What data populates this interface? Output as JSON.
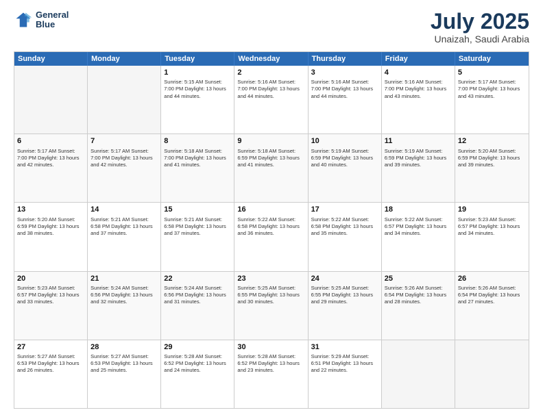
{
  "header": {
    "logo_line1": "General",
    "logo_line2": "Blue",
    "month": "July 2025",
    "location": "Unaizah, Saudi Arabia"
  },
  "days_of_week": [
    "Sunday",
    "Monday",
    "Tuesday",
    "Wednesday",
    "Thursday",
    "Friday",
    "Saturday"
  ],
  "rows": [
    [
      {
        "day": "",
        "info": ""
      },
      {
        "day": "",
        "info": ""
      },
      {
        "day": "1",
        "info": "Sunrise: 5:15 AM\nSunset: 7:00 PM\nDaylight: 13 hours\nand 44 minutes."
      },
      {
        "day": "2",
        "info": "Sunrise: 5:16 AM\nSunset: 7:00 PM\nDaylight: 13 hours\nand 44 minutes."
      },
      {
        "day": "3",
        "info": "Sunrise: 5:16 AM\nSunset: 7:00 PM\nDaylight: 13 hours\nand 44 minutes."
      },
      {
        "day": "4",
        "info": "Sunrise: 5:16 AM\nSunset: 7:00 PM\nDaylight: 13 hours\nand 43 minutes."
      },
      {
        "day": "5",
        "info": "Sunrise: 5:17 AM\nSunset: 7:00 PM\nDaylight: 13 hours\nand 43 minutes."
      }
    ],
    [
      {
        "day": "6",
        "info": "Sunrise: 5:17 AM\nSunset: 7:00 PM\nDaylight: 13 hours\nand 42 minutes."
      },
      {
        "day": "7",
        "info": "Sunrise: 5:17 AM\nSunset: 7:00 PM\nDaylight: 13 hours\nand 42 minutes."
      },
      {
        "day": "8",
        "info": "Sunrise: 5:18 AM\nSunset: 7:00 PM\nDaylight: 13 hours\nand 41 minutes."
      },
      {
        "day": "9",
        "info": "Sunrise: 5:18 AM\nSunset: 6:59 PM\nDaylight: 13 hours\nand 41 minutes."
      },
      {
        "day": "10",
        "info": "Sunrise: 5:19 AM\nSunset: 6:59 PM\nDaylight: 13 hours\nand 40 minutes."
      },
      {
        "day": "11",
        "info": "Sunrise: 5:19 AM\nSunset: 6:59 PM\nDaylight: 13 hours\nand 39 minutes."
      },
      {
        "day": "12",
        "info": "Sunrise: 5:20 AM\nSunset: 6:59 PM\nDaylight: 13 hours\nand 39 minutes."
      }
    ],
    [
      {
        "day": "13",
        "info": "Sunrise: 5:20 AM\nSunset: 6:59 PM\nDaylight: 13 hours\nand 38 minutes."
      },
      {
        "day": "14",
        "info": "Sunrise: 5:21 AM\nSunset: 6:58 PM\nDaylight: 13 hours\nand 37 minutes."
      },
      {
        "day": "15",
        "info": "Sunrise: 5:21 AM\nSunset: 6:58 PM\nDaylight: 13 hours\nand 37 minutes."
      },
      {
        "day": "16",
        "info": "Sunrise: 5:22 AM\nSunset: 6:58 PM\nDaylight: 13 hours\nand 36 minutes."
      },
      {
        "day": "17",
        "info": "Sunrise: 5:22 AM\nSunset: 6:58 PM\nDaylight: 13 hours\nand 35 minutes."
      },
      {
        "day": "18",
        "info": "Sunrise: 5:22 AM\nSunset: 6:57 PM\nDaylight: 13 hours\nand 34 minutes."
      },
      {
        "day": "19",
        "info": "Sunrise: 5:23 AM\nSunset: 6:57 PM\nDaylight: 13 hours\nand 34 minutes."
      }
    ],
    [
      {
        "day": "20",
        "info": "Sunrise: 5:23 AM\nSunset: 6:57 PM\nDaylight: 13 hours\nand 33 minutes."
      },
      {
        "day": "21",
        "info": "Sunrise: 5:24 AM\nSunset: 6:56 PM\nDaylight: 13 hours\nand 32 minutes."
      },
      {
        "day": "22",
        "info": "Sunrise: 5:24 AM\nSunset: 6:56 PM\nDaylight: 13 hours\nand 31 minutes."
      },
      {
        "day": "23",
        "info": "Sunrise: 5:25 AM\nSunset: 6:55 PM\nDaylight: 13 hours\nand 30 minutes."
      },
      {
        "day": "24",
        "info": "Sunrise: 5:25 AM\nSunset: 6:55 PM\nDaylight: 13 hours\nand 29 minutes."
      },
      {
        "day": "25",
        "info": "Sunrise: 5:26 AM\nSunset: 6:54 PM\nDaylight: 13 hours\nand 28 minutes."
      },
      {
        "day": "26",
        "info": "Sunrise: 5:26 AM\nSunset: 6:54 PM\nDaylight: 13 hours\nand 27 minutes."
      }
    ],
    [
      {
        "day": "27",
        "info": "Sunrise: 5:27 AM\nSunset: 6:53 PM\nDaylight: 13 hours\nand 26 minutes."
      },
      {
        "day": "28",
        "info": "Sunrise: 5:27 AM\nSunset: 6:53 PM\nDaylight: 13 hours\nand 25 minutes."
      },
      {
        "day": "29",
        "info": "Sunrise: 5:28 AM\nSunset: 6:52 PM\nDaylight: 13 hours\nand 24 minutes."
      },
      {
        "day": "30",
        "info": "Sunrise: 5:28 AM\nSunset: 6:52 PM\nDaylight: 13 hours\nand 23 minutes."
      },
      {
        "day": "31",
        "info": "Sunrise: 5:29 AM\nSunset: 6:51 PM\nDaylight: 13 hours\nand 22 minutes."
      },
      {
        "day": "",
        "info": ""
      },
      {
        "day": "",
        "info": ""
      }
    ]
  ]
}
